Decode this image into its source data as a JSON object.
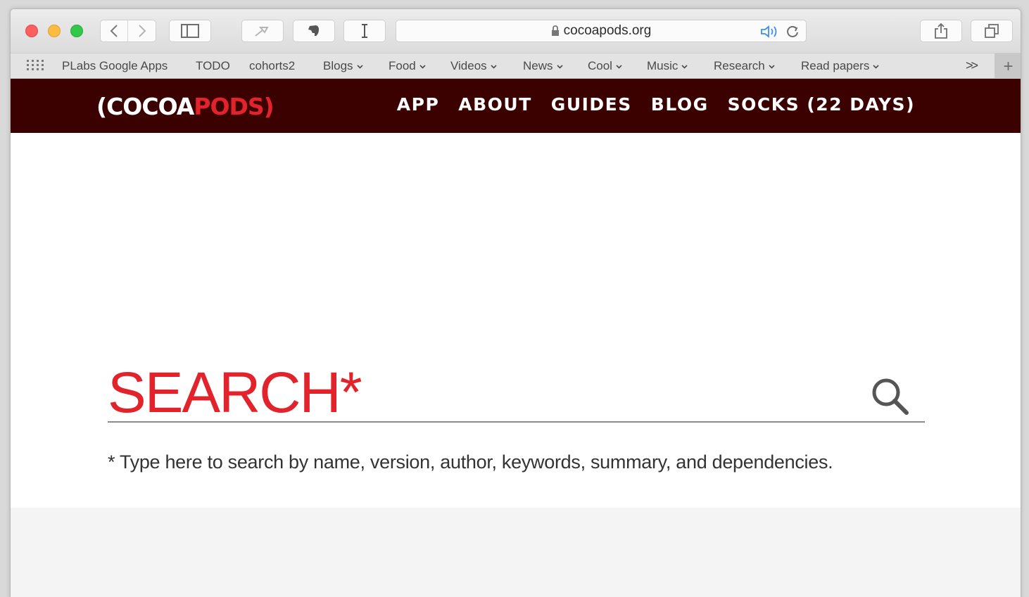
{
  "browser": {
    "address": "cocoapods.org",
    "bookmarks": [
      {
        "label": "PLabs Google Apps",
        "menu": false
      },
      {
        "label": "TODO",
        "menu": false
      },
      {
        "label": "cohorts2",
        "menu": false
      },
      {
        "label": "Blogs",
        "menu": true
      },
      {
        "label": "Food",
        "menu": true
      },
      {
        "label": "Videos",
        "menu": true
      },
      {
        "label": "News",
        "menu": true
      },
      {
        "label": "Cool",
        "menu": true
      },
      {
        "label": "Music",
        "menu": true
      },
      {
        "label": "Research",
        "menu": true
      },
      {
        "label": "Read papers",
        "menu": true
      }
    ],
    "more": ">>",
    "add": "+"
  },
  "site": {
    "logo": {
      "left": "(COCOA",
      "right": "PODS)"
    },
    "nav": [
      "APP",
      "ABOUT",
      "GUIDES",
      "BLOG",
      "SOCKS (22 DAYS)"
    ]
  },
  "search": {
    "placeholder": "SEARCH*",
    "hint": "* Type here to search by name, version, author, keywords, summary, and dependencies."
  },
  "colors": {
    "header_bg": "#3a0100",
    "accent": "#e3232b"
  }
}
